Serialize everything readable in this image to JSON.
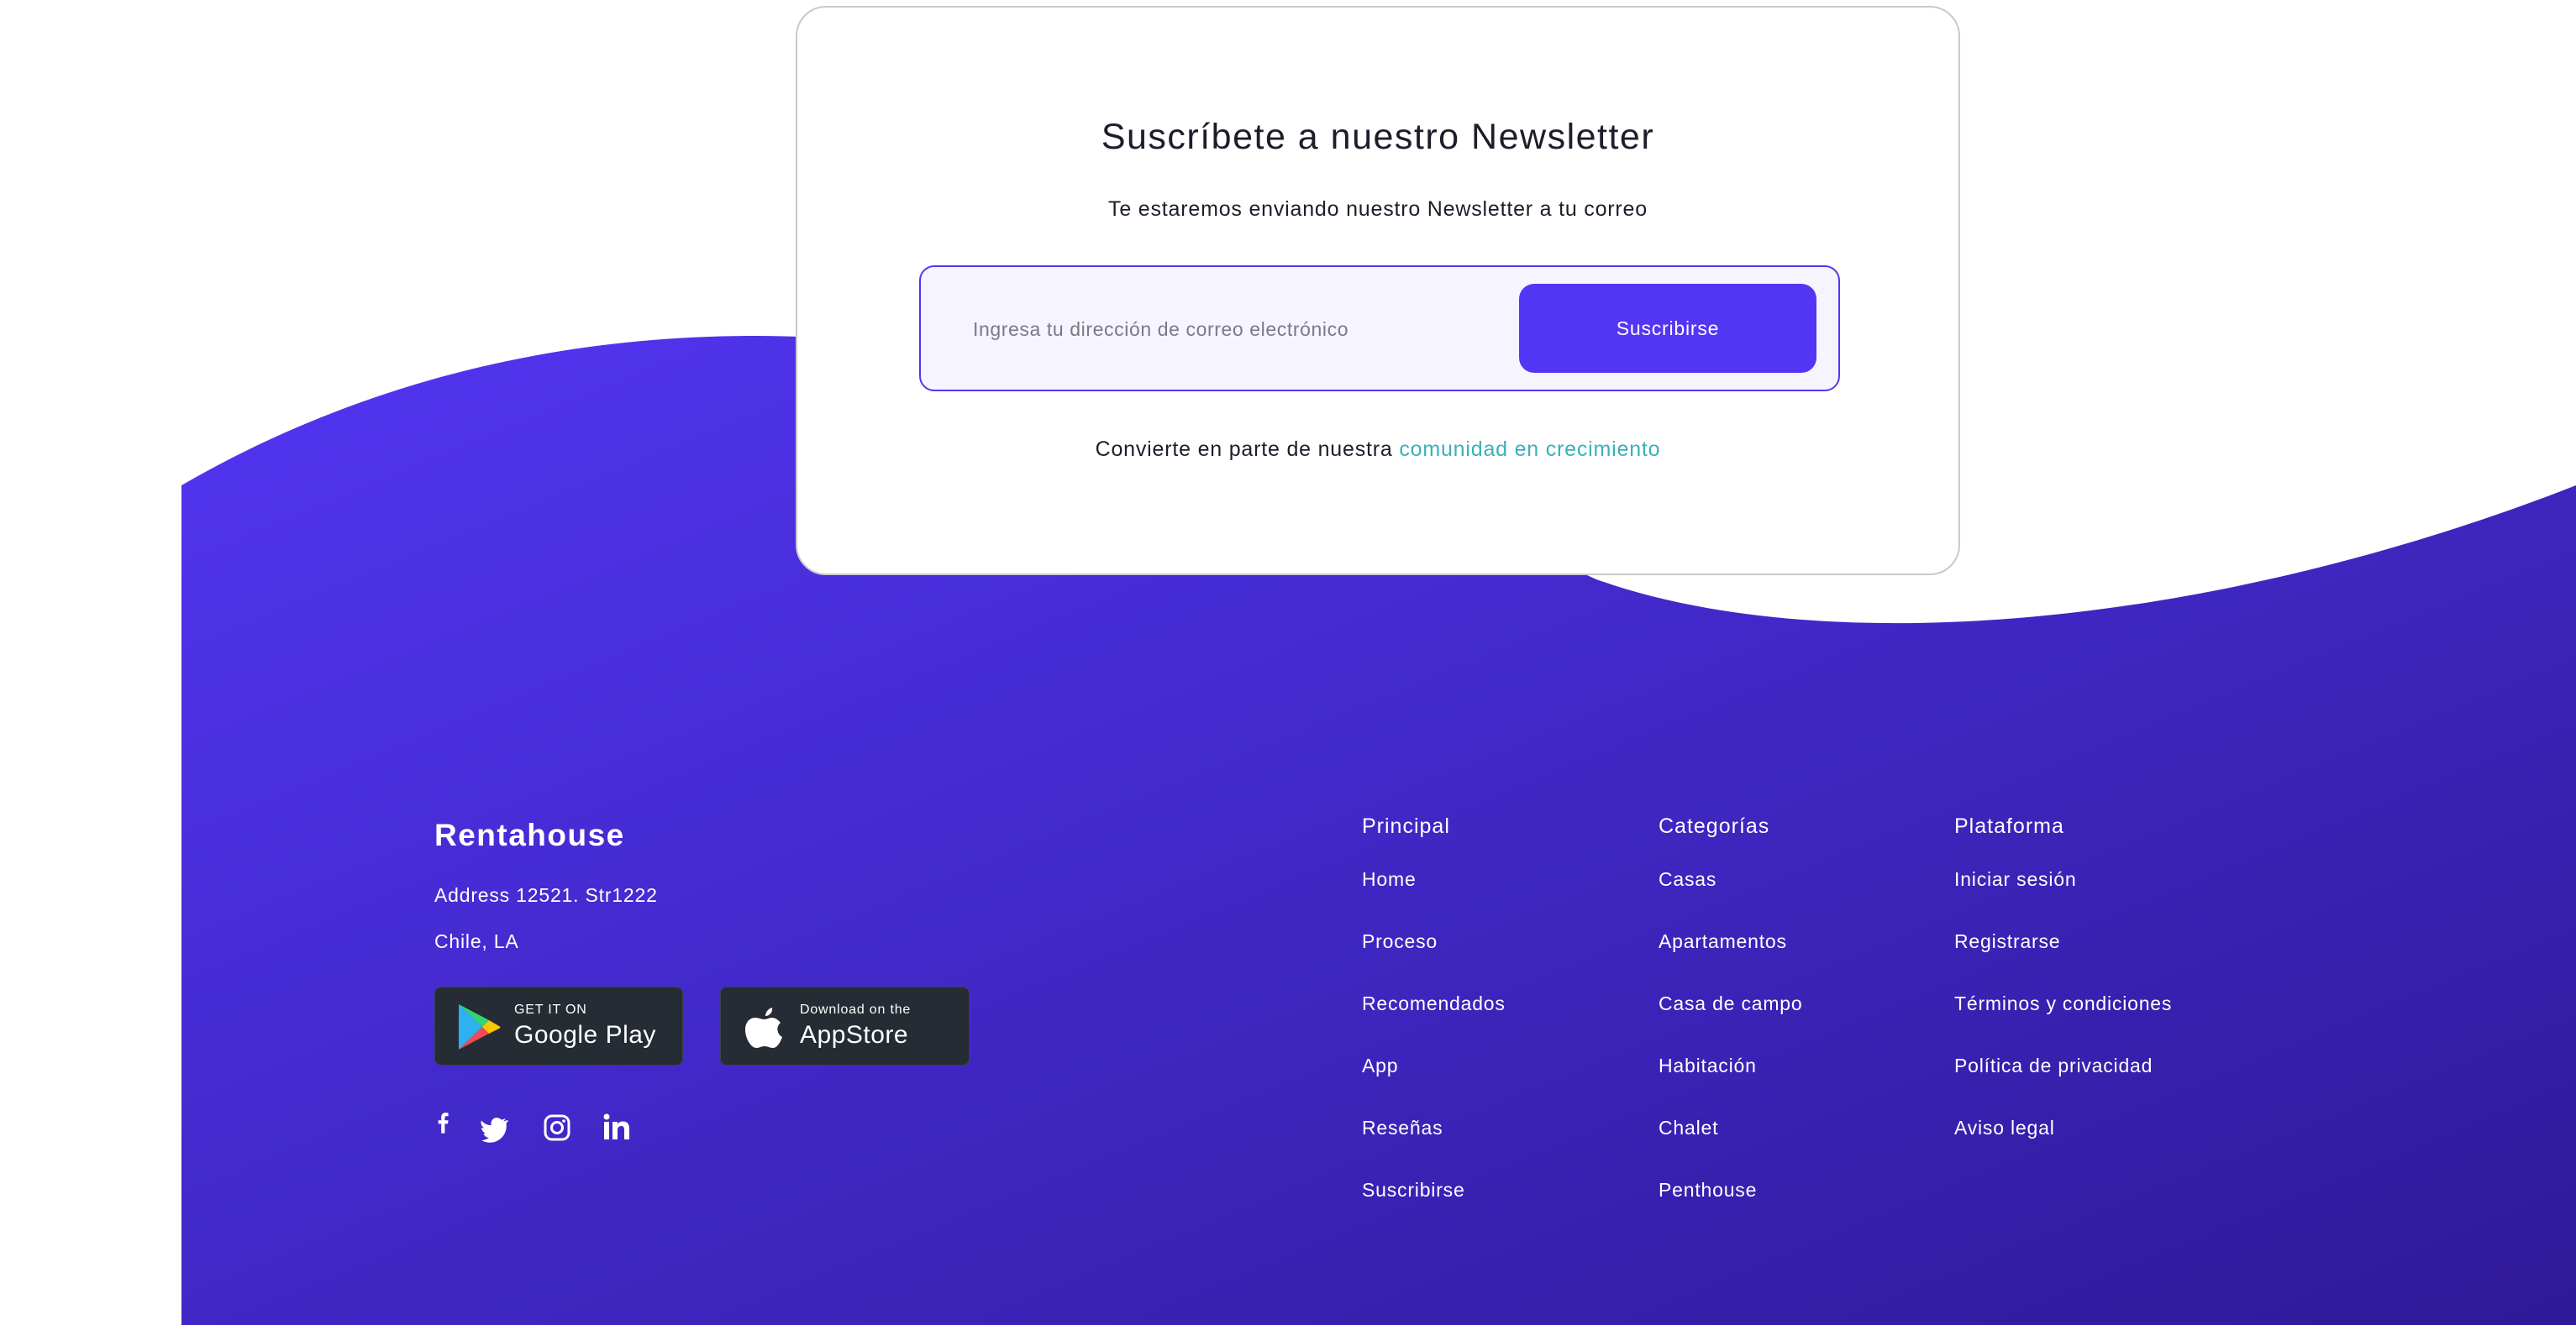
{
  "newsletter": {
    "title": "Suscríbete a nuestro Newsletter",
    "subtitle": "Te estaremos enviando nuestro Newsletter a tu correo",
    "email_placeholder": "Ingresa tu dirección de correo electrónico",
    "email_value": "",
    "button_label": "Suscribirse",
    "footer_text": "Convierte en parte de nuestra",
    "footer_link": "comunidad en crecimiento"
  },
  "footer": {
    "brand": "Rentahouse",
    "address_line1": "Address 12521. Str1222",
    "address_line2": "Chile, LA",
    "stores": {
      "google": {
        "small": "GET IT ON",
        "big": "Google Play",
        "icon": "google-play-icon"
      },
      "apple": {
        "small": "Download on the",
        "big": "AppStore",
        "icon": "apple-icon"
      }
    },
    "social": [
      "facebook-icon",
      "twitter-icon",
      "instagram-icon",
      "linkedin-icon"
    ],
    "columns": [
      {
        "title": "Principal",
        "links": [
          "Home",
          "Proceso",
          "Recomendados",
          "App",
          "Reseñas",
          "Suscribirse"
        ]
      },
      {
        "title": "Categorías",
        "links": [
          "Casas",
          "Apartamentos",
          "Casa de campo",
          "Habitación",
          "Chalet",
          "Penthouse"
        ]
      },
      {
        "title": "Plataforma",
        "links": [
          "Iniciar sesión",
          "Registrarse",
          "Términos y condiciones",
          "Política de privacidad",
          "Aviso legal"
        ]
      }
    ]
  },
  "colors": {
    "accent": "#5336f4",
    "gradient_start": "#5336f4",
    "gradient_end": "#2e1997",
    "link_teal": "#3ab0b8",
    "store_bg": "#252c33"
  }
}
